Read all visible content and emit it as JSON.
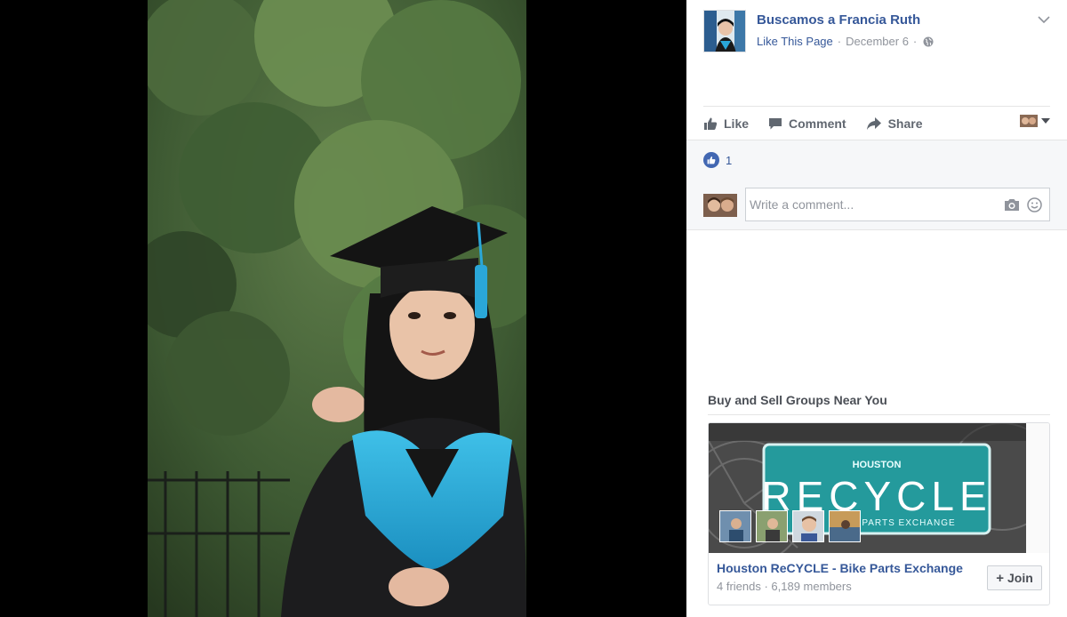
{
  "post": {
    "page_name": "Buscamos a Francia Ruth",
    "like_page_label": "Like This Page",
    "date": "December 6",
    "separator": "·"
  },
  "actions": {
    "like": "Like",
    "comment": "Comment",
    "share": "Share"
  },
  "reactions": {
    "count": "1"
  },
  "comment_box": {
    "placeholder": "Write a comment..."
  },
  "suggestions": {
    "title": "Buy and Sell Groups Near You",
    "group": {
      "name": "Houston ReCYCLE - Bike Parts Exchange",
      "meta": "4 friends · 6,189 members",
      "join_label": "Join",
      "join_icon": "+",
      "logo_small": "HOUSTON",
      "logo_big": "RECYCLE",
      "logo_sub": "PARTS EXCHANGE"
    }
  },
  "colors": {
    "link": "#365899",
    "brand_blue": "#4267b2",
    "logo_teal": "#2fa8a8"
  }
}
